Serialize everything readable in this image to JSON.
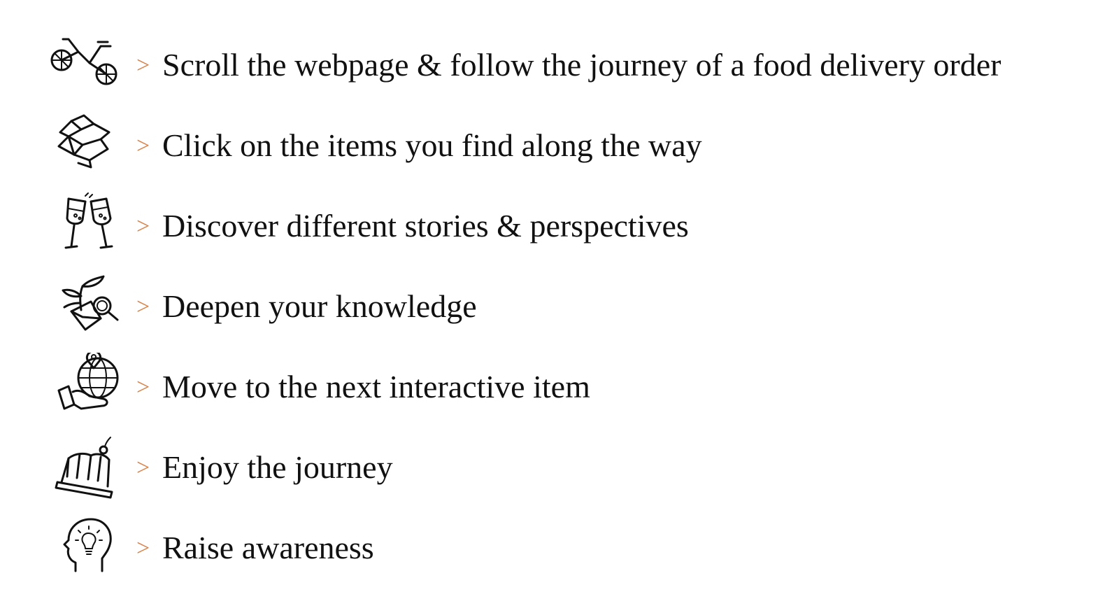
{
  "arrow_glyph": ">",
  "arrow_color": "#d9824a",
  "text_color": "#111111",
  "steps": [
    {
      "icon": "bicycle-icon",
      "label": "Scroll the webpage & follow the journey of a food delivery order"
    },
    {
      "icon": "open-box-icon",
      "label": "Click on the items you find along the way"
    },
    {
      "icon": "wine-glasses-icon",
      "label": "Discover different stories & perspectives"
    },
    {
      "icon": "plant-magnifier-icon",
      "label": "Deepen your knowledge"
    },
    {
      "icon": "globe-hand-icon",
      "label": "Move to the next interactive item"
    },
    {
      "icon": "cake-icon",
      "label": "Enjoy the journey"
    },
    {
      "icon": "head-lightbulb-icon",
      "label": "Raise awareness"
    }
  ]
}
